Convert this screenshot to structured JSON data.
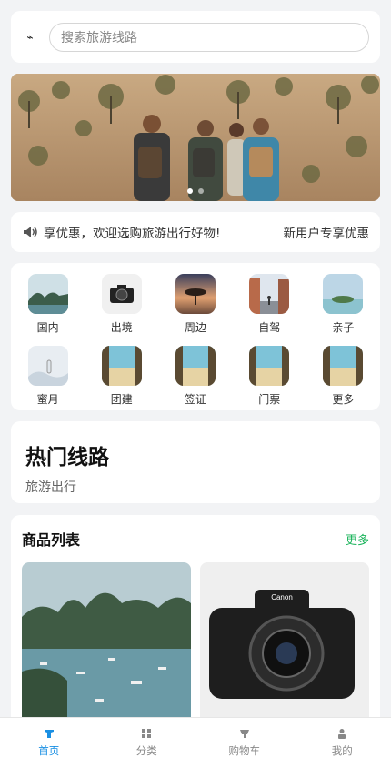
{
  "header": {
    "logo_icon": "lightning-icon",
    "search_placeholder": "搜索旅游线路"
  },
  "banner": {
    "slide_count": 2,
    "active_index": 0
  },
  "notice": {
    "icon": "speaker-icon",
    "text": "享优惠，欢迎选购旅游出行好物!",
    "right_text": "新用户专享优惠"
  },
  "categories": [
    {
      "label": "国内"
    },
    {
      "label": "出境"
    },
    {
      "label": "周边"
    },
    {
      "label": "自驾"
    },
    {
      "label": "亲子"
    },
    {
      "label": "蜜月"
    },
    {
      "label": "团建"
    },
    {
      "label": "签证"
    },
    {
      "label": "门票"
    },
    {
      "label": "更多"
    }
  ],
  "hot": {
    "title": "热门线路",
    "subtitle": "旅游出行"
  },
  "goods": {
    "title": "商品列表",
    "more": "更多",
    "accent_color": "#19b35a"
  },
  "tabbar": {
    "active_color": "#1a8fe3",
    "items": [
      {
        "label": "首页",
        "icon": "home-icon"
      },
      {
        "label": "分类",
        "icon": "grid-icon"
      },
      {
        "label": "购物车",
        "icon": "cart-icon"
      },
      {
        "label": "我的",
        "icon": "user-icon"
      }
    ]
  }
}
